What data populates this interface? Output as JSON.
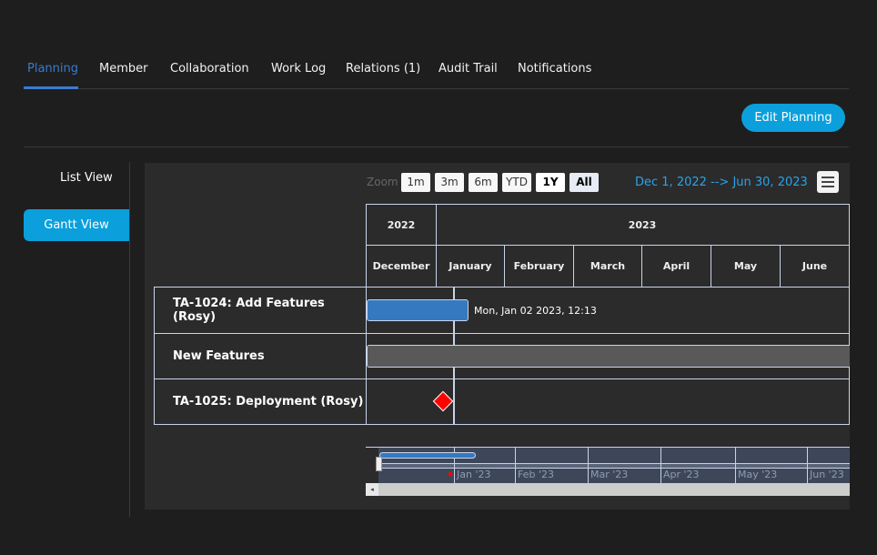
{
  "tabs": [
    {
      "label": "Planning",
      "active": true
    },
    {
      "label": "Member"
    },
    {
      "label": "Collaboration"
    },
    {
      "label": "Work Log"
    },
    {
      "label": "Relations (1)"
    },
    {
      "label": "Audit Trail"
    },
    {
      "label": "Notifications"
    }
  ],
  "edit_planning_label": "Edit Planning",
  "sidebar": {
    "list_view": "List View",
    "gantt_view": "Gantt View",
    "active": "Gantt View"
  },
  "gantt": {
    "zoom_label": "Zoom",
    "zoom_buttons": [
      "1m",
      "3m",
      "6m",
      "YTD",
      "1Y",
      "All"
    ],
    "zoom_selected": "All",
    "range_text": "Dec 1, 2022 --> Jun 30, 2023",
    "menu_icon": "hamburger-menu-icon",
    "years": [
      "2022",
      "2023"
    ],
    "months": [
      "December",
      "January",
      "February",
      "March",
      "April",
      "May",
      "June"
    ],
    "tasks": [
      {
        "name": "TA-1024: Add Features (Rosy)",
        "type": "bar",
        "color": "#3579c0",
        "label": "Mon, Jan 02 2023, 12:13"
      },
      {
        "name": "New Features",
        "type": "bar",
        "color": "#595959"
      },
      {
        "name": "TA-1025: Deployment (Rosy)",
        "type": "milestone",
        "color": "#ff0000"
      }
    ],
    "navigator_labels": [
      "Jan '23",
      "Feb '23",
      "Mar '23",
      "Apr '23",
      "May '23",
      "Jun '23"
    ]
  },
  "colors": {
    "accent": "#0b9fdc",
    "active_tab": "#3a7bd0",
    "range": "#2aa3e8"
  }
}
